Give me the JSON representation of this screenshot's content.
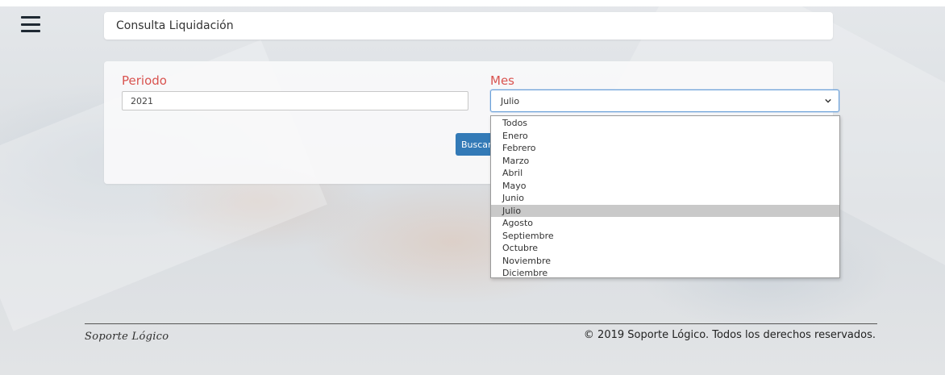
{
  "header": {
    "title": "Consulta Liquidación"
  },
  "form": {
    "periodo_label": "Periodo",
    "periodo_value": "2021",
    "mes_label": "Mes",
    "mes_selected": "Julio",
    "buscar_label": "Buscar",
    "mes_options": [
      "Todos",
      "Enero",
      "Febrero",
      "Marzo",
      "Abril",
      "Mayo",
      "Junio",
      "Julio",
      "Agosto",
      "Septiembre",
      "Octubre",
      "Noviembre",
      "Diciembre"
    ]
  },
  "footer": {
    "logo": "Soporte Lógico",
    "copyright": "© 2019 Soporte Lógico. Todos los derechos reservados."
  },
  "icons": {
    "menu": "hamburger-menu-icon",
    "select_arrow": "chevron-down-icon"
  },
  "colors": {
    "label_red": "#d9534f",
    "primary_blue": "#337ab7",
    "focus_border": "#6aa0d8",
    "selected_option": "#c9c9c9"
  }
}
